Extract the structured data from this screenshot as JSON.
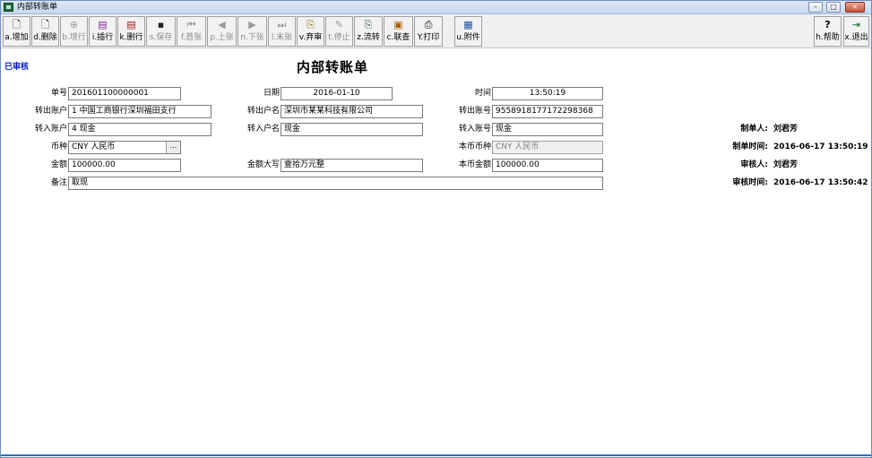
{
  "window": {
    "title": "内部转账单",
    "controls": {
      "minimize": "–",
      "maximize": "□",
      "close": "×"
    }
  },
  "toolbar": {
    "buttons": [
      {
        "label": "a.增加",
        "icon": "🗋",
        "enabled": true
      },
      {
        "label": "d.删除",
        "icon": "🗋",
        "enabled": true
      },
      {
        "label": "b.增行",
        "icon": "⊕",
        "enabled": false
      },
      {
        "label": "i.插行",
        "icon": "▤",
        "enabled": true
      },
      {
        "label": "k.删行",
        "icon": "▤",
        "enabled": true
      },
      {
        "label": "s.保存",
        "icon": "▪",
        "enabled": false
      },
      {
        "label": "f.首张",
        "icon": "⏮",
        "enabled": false
      },
      {
        "label": "p.上张",
        "icon": "◀",
        "enabled": false
      },
      {
        "label": "n.下张",
        "icon": "▶",
        "enabled": false
      },
      {
        "label": "l.末张",
        "icon": "⏭",
        "enabled": false
      },
      {
        "label": "v.弃审",
        "icon": "⎘",
        "enabled": true
      },
      {
        "label": "t.停止",
        "icon": "✎",
        "enabled": false
      },
      {
        "label": "z.流转",
        "icon": "⎘",
        "enabled": true
      },
      {
        "label": "c.联查",
        "icon": "▣",
        "enabled": true
      },
      {
        "label": "Y.打印",
        "icon": "⎙",
        "enabled": true
      },
      {
        "label": "u.附件",
        "icon": "▦",
        "enabled": true
      }
    ],
    "help_label": "h.帮助",
    "exit_label": "x.退出"
  },
  "document": {
    "status": "已审核",
    "title": "内部转账单",
    "fields": {
      "doc_no": {
        "label": "单号",
        "value": "201601100000001"
      },
      "date": {
        "label": "日期",
        "value": "2016-01-10"
      },
      "time": {
        "label": "时间",
        "value": "13:50:19"
      },
      "out_account": {
        "label": "转出账户",
        "value": "1 中国工商银行深圳福田支行"
      },
      "out_name": {
        "label": "转出户名",
        "value": "深圳市某某科技有限公司"
      },
      "out_number": {
        "label": "转出账号",
        "value": "9558918177172298368"
      },
      "in_account": {
        "label": "转入账户",
        "value": "4 现金"
      },
      "in_name": {
        "label": "转入户名",
        "value": "现金"
      },
      "in_number": {
        "label": "转入账号",
        "value": "现金"
      },
      "currency": {
        "label": "币种",
        "value": "CNY 人民币"
      },
      "base_currency": {
        "label": "本币币种",
        "value": "CNY 人民币"
      },
      "amount": {
        "label": "金额",
        "value": "100000.00"
      },
      "amount_words": {
        "label": "金额大写",
        "value": "壹拾万元整"
      },
      "base_amount": {
        "label": "本币金额",
        "value": "100000.00"
      },
      "remark": {
        "label": "备注",
        "value": "取现"
      }
    },
    "audit": {
      "maker_label": "制单人:",
      "maker": "刘君芳",
      "make_time_label": "制单时间:",
      "make_time": "2016-06-17 13:50:19",
      "auditor_label": "审核人:",
      "auditor": "刘君芳",
      "audit_time_label": "审核时间:",
      "audit_time": "2016-06-17 13:50:42"
    }
  }
}
